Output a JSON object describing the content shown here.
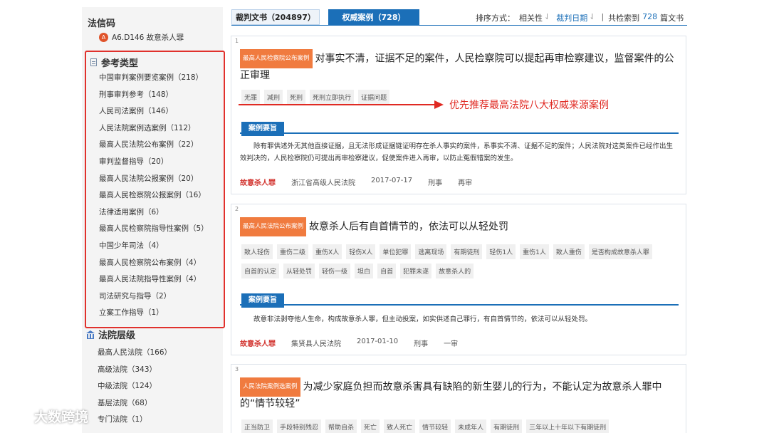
{
  "sidebar": {
    "code_title": "法信码",
    "code_badge": "A",
    "code_value": "A6.D146 故意杀人罪",
    "ref_type_title": "参考类型",
    "ref_types": [
      "中国审判案例要览案例（218）",
      "刑事审判参考（148）",
      "人民司法案例（146）",
      "人民法院案例选案例（112）",
      "最高人民法院公布案例（22）",
      "审判监督指导（20）",
      "最高人民法院公报案例（20）",
      "最高人民检察院公报案例（16）",
      "法律适用案例（6）",
      "最高人民检察院指导性案例（5）",
      "中国少年司法（4）",
      "最高人民检察院公布案例（4）",
      "最高人民法院指导性案例（4）",
      "司法研究与指导（2）",
      "立案工作指导（1）"
    ],
    "court_level_title": "法院层级",
    "court_levels": [
      "最高人民法院（166）",
      "高级法院（343）",
      "中级法院（124）",
      "基层法院（68）",
      "专门法院（1）"
    ]
  },
  "tabs": {
    "judgments": "裁判文书（204897）",
    "authority": "权威案例（728）"
  },
  "sort": {
    "label": "排序方式：",
    "relevance": "相关性",
    "date": "裁判日期",
    "sep": "|",
    "total_prefix": "共检索到",
    "total_count": "728",
    "total_suffix": "篇文书"
  },
  "annotation": "优先推荐最高法院八大权威来源案例",
  "results": [
    {
      "no": "1",
      "source_tag": "最高人民检察院公布案例",
      "title": "对事实不清，证据不足的案件，人民检察院可以提起再审检察建议，监督案件的公正审理",
      "keywords": [
        "无罪",
        "减刑",
        "死刑",
        "死刑立即执行",
        "证据问题"
      ],
      "section_label": "案例要旨",
      "summary": "除有罪供述外无其他直接证据，且无法形成证据链证明存在杀人事实的案件，系事实不清、证据不足的案件；人民法院对这类案件已经作出生效判决的，人民检察院仍可提出再审检察建议，促使案件进入再审，以防止冤假错案的发生。",
      "crime": "故意杀人罪",
      "court": "浙江省高级人民法院",
      "date": "2017-07-17",
      "case_type": "刑事",
      "procedure": "再审"
    },
    {
      "no": "2",
      "source_tag": "最高人民法院公布案例",
      "title": "故意杀人后有自首情节的，依法可以从轻处罚",
      "keywords": [
        "致人轻伤",
        "重伤二级",
        "重伤X人",
        "轻伤X人",
        "单位犯罪",
        "逃离现场",
        "有期徒刑",
        "轻伤1人",
        "重伤1人",
        "致人重伤",
        "是否构成故意杀人罪",
        "自首的认定",
        "从轻处罚",
        "轻伤一级",
        "坦白",
        "自首",
        "犯罪未遂",
        "故意杀人的"
      ],
      "section_label": "案例要旨",
      "summary": "故意非法剥夺他人生命，构成故意杀人罪，但主动投案，如实供述自己罪行，有自首情节的，依法可以从轻处罚。",
      "crime": "故意杀人罪",
      "court": "集贤县人民法院",
      "date": "2017-01-10",
      "case_type": "刑事",
      "procedure": "一审"
    },
    {
      "no": "3",
      "source_tag": "人民法院案例选案例",
      "title": "为减少家庭负担而故意杀害具有缺陷的新生婴儿的行为，不能认定为故意杀人罪中的“情节较轻”",
      "keywords": [
        "正当防卫",
        "手段特别残忍",
        "帮助自杀",
        "死亡",
        "致人死亡",
        "情节较轻",
        "未成年人",
        "有期徒刑",
        "三年以上十年以下有期徒刑"
      ]
    }
  ],
  "watermark": "大数跨境",
  "colors": {
    "accent": "#1b6fb8",
    "tag": "#f07b3f",
    "highlight": "#e02a23"
  }
}
